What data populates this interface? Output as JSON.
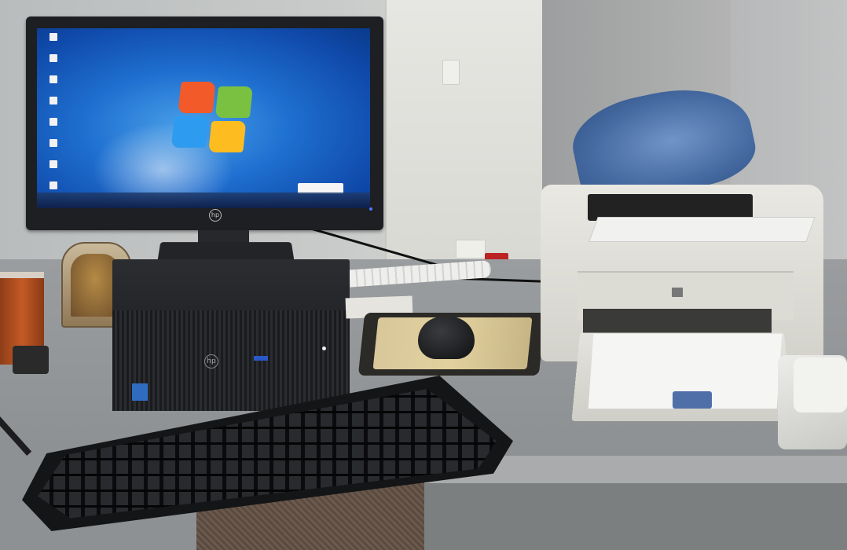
{
  "scene": {
    "description_objects": [
      "monitor",
      "desktop-tower",
      "keyboard",
      "mouse",
      "mouse-pad",
      "printer",
      "water-bottle",
      "icon-frame",
      "mug",
      "telephone"
    ],
    "colors": {
      "screen_blue": "#1e6fd0",
      "device_black": "#17181b",
      "printer_beige": "#e9e8e2",
      "bottle_blue": "#3f66a0"
    },
    "monitor": {
      "brand_mark": "hp"
    },
    "tower": {
      "brand_mark": "hp"
    }
  }
}
